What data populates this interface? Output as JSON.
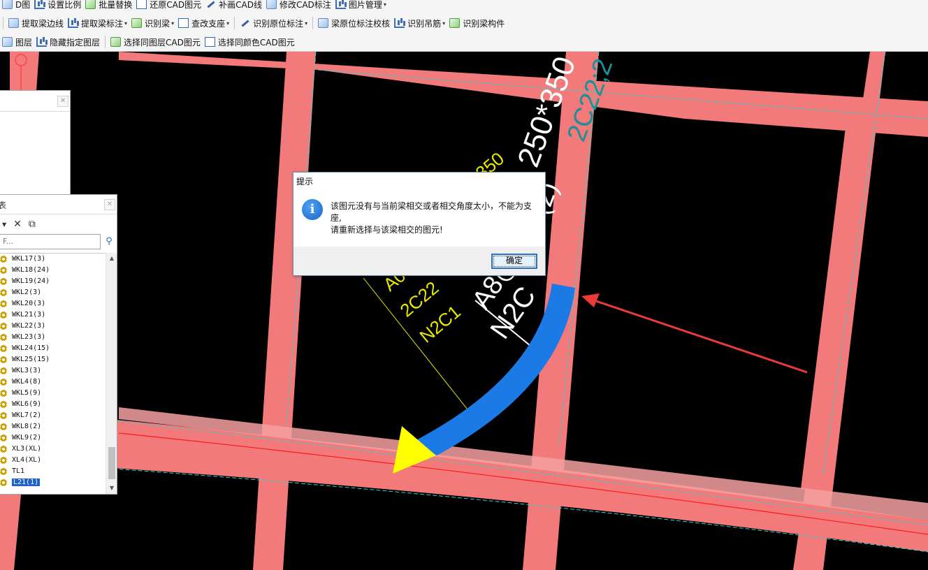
{
  "toolbar": {
    "row1": [
      {
        "label": "D图",
        "icon": "image-icon"
      },
      {
        "label": "设置比例",
        "icon": "scale-icon"
      },
      {
        "label": "批量替换",
        "icon": "batch-replace-icon"
      },
      {
        "label": "还原CAD图元",
        "icon": "restore-cad-icon"
      },
      {
        "label": "补画CAD线",
        "icon": "draw-cad-line-icon"
      },
      {
        "label": "修改CAD标注",
        "icon": "edit-cad-annotation-icon"
      },
      {
        "label": "图片管理",
        "icon": "image-manage-icon",
        "dropdown": true
      }
    ],
    "row2": [
      {
        "label": "提取梁边线",
        "icon": "extract-beam-edge-icon"
      },
      {
        "label": "提取梁标注",
        "icon": "extract-beam-annotation-icon",
        "dropdown": true
      },
      {
        "label": "识别梁",
        "icon": "identify-beam-icon",
        "dropdown": true
      },
      {
        "label": "查改支座",
        "icon": "check-support-icon",
        "dropdown": true
      },
      {
        "label": "识别原位标注",
        "icon": "identify-inplace-annotation-icon",
        "dropdown": true
      },
      {
        "label": "梁原位标注校核",
        "icon": "beam-annotation-check-icon"
      },
      {
        "label": "识别吊筋",
        "icon": "identify-hanger-icon",
        "dropdown": true
      },
      {
        "label": "识别梁构件",
        "icon": "identify-beam-component-icon"
      }
    ],
    "row3": [
      {
        "label": "图层",
        "icon": "layer-icon"
      },
      {
        "label": "隐藏指定图层",
        "icon": "hide-layer-icon"
      },
      {
        "label": "选择同图层CAD图元",
        "icon": "select-same-layer-icon"
      },
      {
        "label": "选择同颜色CAD图元",
        "icon": "select-same-color-icon"
      }
    ]
  },
  "component_panel": {
    "title": "表",
    "search_placeholder": "F...",
    "items": [
      "WKL17(3)",
      "WKL18(24)",
      "WKL19(24)",
      "WKL2(3)",
      "WKL20(3)",
      "WKL21(3)",
      "WKL22(3)",
      "WKL23(3)",
      "WKL24(15)",
      "WKL25(15)",
      "WKL3(3)",
      "WKL4(8)",
      "WKL5(9)",
      "WKL6(9)",
      "WKL7(2)",
      "WKL8(2)",
      "WKL9(2)",
      "XL3(XL)",
      "XL4(XL)",
      "TL1",
      "L21(1)"
    ],
    "selected_item": "L21(1)"
  },
  "dialog": {
    "title": "提示",
    "message_line1": "该图元没有与当前梁相交或者相交角度太小，不能为支座,",
    "message_line2": "请重新选择与该梁相交的图元!",
    "ok_label": "确定"
  },
  "cad_annotations": {
    "teal_section": "250*350",
    "teal_rebar": "2C22;2",
    "white_stirrup": "A8@",
    "white_torsion": "N2C",
    "white_extra": "(2)",
    "yellow_section": "350",
    "yellow_a": "A0",
    "yellow_rebar": "2C22",
    "yellow_torsion": "N2C1"
  },
  "colors": {
    "canvas_bg": "#000000",
    "beam_fill": "#f27a7a",
    "selected_beam": "#1b7ae6",
    "arrow_yellow": "#ffff00",
    "callout_arrow": "#ea3b3b",
    "teal_text": "#1d8f96",
    "yellow_text": "#e8e800",
    "white_text": "#ffffff"
  }
}
